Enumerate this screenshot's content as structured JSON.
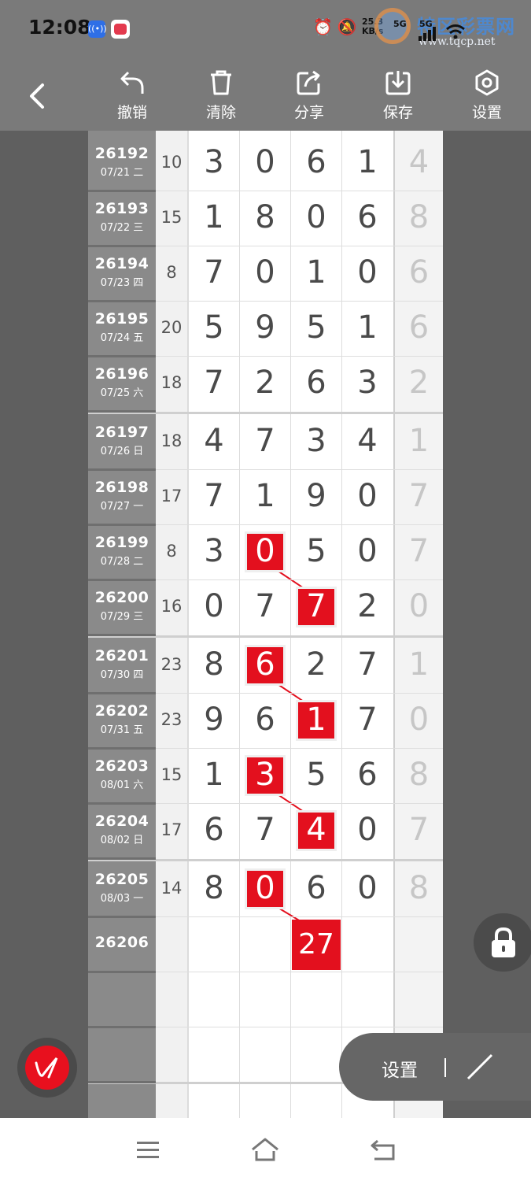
{
  "status_bar": {
    "time": "12:08",
    "app_icon_1": "((•))",
    "net_speed_top": "25.3",
    "net_speed_bottom": "KB/s",
    "signal_label": "5G",
    "watermark_title": "特区彩票网",
    "watermark_url": "www.tqcp.net"
  },
  "toolbar": {
    "undo": "撤销",
    "clear": "清除",
    "share": "分享",
    "save": "保存",
    "settings": "设置"
  },
  "rows": [
    {
      "issue": "26192",
      "date": "07/21 二",
      "sum": "10",
      "digits": [
        "3",
        "0",
        "6",
        "1"
      ],
      "extra": "4"
    },
    {
      "issue": "26193",
      "date": "07/22 三",
      "sum": "15",
      "digits": [
        "1",
        "8",
        "0",
        "6"
      ],
      "extra": "8"
    },
    {
      "issue": "26194",
      "date": "07/23 四",
      "sum": "8",
      "digits": [
        "7",
        "0",
        "1",
        "0"
      ],
      "extra": "6"
    },
    {
      "issue": "26195",
      "date": "07/24 五",
      "sum": "20",
      "digits": [
        "5",
        "9",
        "5",
        "1"
      ],
      "extra": "6"
    },
    {
      "issue": "26196",
      "date": "07/25 六",
      "sum": "18",
      "digits": [
        "7",
        "2",
        "6",
        "3"
      ],
      "extra": "2"
    },
    {
      "issue": "26197",
      "date": "07/26 日",
      "sum": "18",
      "digits": [
        "4",
        "7",
        "3",
        "4"
      ],
      "extra": "1"
    },
    {
      "issue": "26198",
      "date": "07/27 一",
      "sum": "17",
      "digits": [
        "7",
        "1",
        "9",
        "0"
      ],
      "extra": "7"
    },
    {
      "issue": "26199",
      "date": "07/28 二",
      "sum": "8",
      "digits": [
        "3",
        "0",
        "5",
        "0"
      ],
      "extra": "7"
    },
    {
      "issue": "26200",
      "date": "07/29 三",
      "sum": "16",
      "digits": [
        "0",
        "7",
        "7",
        "2"
      ],
      "extra": "0"
    },
    {
      "issue": "26201",
      "date": "07/30 四",
      "sum": "23",
      "digits": [
        "8",
        "6",
        "2",
        "7"
      ],
      "extra": "1"
    },
    {
      "issue": "26202",
      "date": "07/31 五",
      "sum": "23",
      "digits": [
        "9",
        "6",
        "1",
        "7"
      ],
      "extra": "0"
    },
    {
      "issue": "26203",
      "date": "08/01 六",
      "sum": "15",
      "digits": [
        "1",
        "3",
        "5",
        "6"
      ],
      "extra": "8"
    },
    {
      "issue": "26204",
      "date": "08/02 日",
      "sum": "17",
      "digits": [
        "6",
        "7",
        "4",
        "0"
      ],
      "extra": "7"
    },
    {
      "issue": "26205",
      "date": "08/03 一",
      "sum": "14",
      "digits": [
        "8",
        "0",
        "6",
        "0"
      ],
      "extra": "8"
    },
    {
      "issue": "26206",
      "date": "",
      "sum": "",
      "digits": [
        "",
        "",
        "",
        ""
      ],
      "extra": ""
    }
  ],
  "highlights": [
    {
      "row": 7,
      "col": 1
    },
    {
      "row": 8,
      "col": 2
    },
    {
      "row": 9,
      "col": 1
    },
    {
      "row": 10,
      "col": 2
    },
    {
      "row": 11,
      "col": 1
    },
    {
      "row": 12,
      "col": 2
    },
    {
      "row": 13,
      "col": 1
    }
  ],
  "prediction": "27",
  "floating": {
    "settings_label": "设置"
  },
  "colors": {
    "highlight": "#e3101e",
    "id_column": "#8a8a8a",
    "toolbar": "#7a7a7a"
  },
  "icons": {
    "back": "chevron-left-icon",
    "undo": "undo-arrow-icon",
    "clear": "trash-icon",
    "share": "share-icon",
    "save": "download-icon",
    "settings": "hexagon-gear-icon",
    "lock": "lock-icon",
    "pen": "pen-signature-icon",
    "line": "diagonal-line-icon"
  }
}
